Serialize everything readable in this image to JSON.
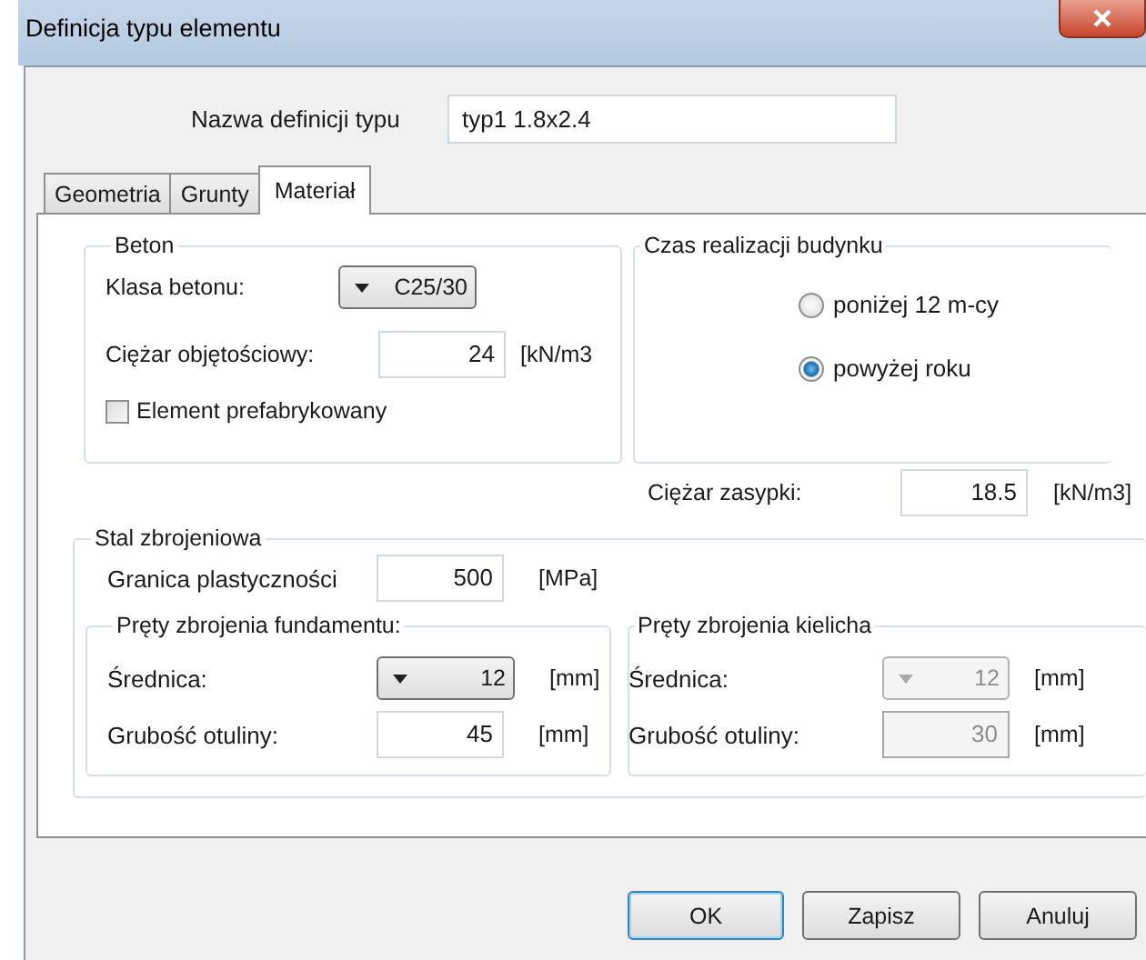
{
  "window": {
    "title": "Definicja typu elementu"
  },
  "type_name": {
    "label": "Nazwa definicji typu",
    "value": "typ1 1.8x2.4"
  },
  "tabs": [
    {
      "label": "Geometria",
      "selected": false
    },
    {
      "label": "Grunty",
      "selected": false
    },
    {
      "label": "Materiał",
      "selected": true
    }
  ],
  "concrete": {
    "title": "Beton",
    "concrete_class": {
      "label": "Klasa betonu:",
      "value": "C25/30"
    },
    "unit_weight": {
      "label": "Ciężar objętościowy:",
      "value": "24",
      "unit": "[kN/m3"
    },
    "precast": {
      "label": "Element prefabrykowany",
      "checked": false
    }
  },
  "construction_time": {
    "title": "Czas realizacji budynku",
    "options": [
      {
        "label": "poniżej 12 m-cy",
        "selected": false
      },
      {
        "label": "powyżej roku",
        "selected": true
      }
    ]
  },
  "backfill_weight": {
    "label": "Ciężar zasypki:",
    "value": "18.5",
    "unit": "[kN/m3]"
  },
  "steel": {
    "title": "Stal zbrojeniowa",
    "yield_strength": {
      "label": "Granica plastyczności",
      "value": "500",
      "unit": "[MPa]"
    },
    "bar_groups": [
      {
        "title": "Pręty zbrojenia fundamentu:",
        "disabled": false,
        "diameter": {
          "label": "Średnica:",
          "value": "12",
          "unit": "[mm]"
        },
        "cover": {
          "label": "Grubość otuliny:",
          "value": "45",
          "unit": "[mm]"
        }
      },
      {
        "title": "Pręty zbrojenia kielicha",
        "disabled": true,
        "diameter": {
          "label": "Średnica:",
          "value": "12",
          "unit": "[mm]"
        },
        "cover": {
          "label": "Grubość otuliny:",
          "value": "30",
          "unit": "[mm]"
        }
      }
    ]
  },
  "buttons": [
    {
      "label": "OK",
      "default": true
    },
    {
      "label": "Zapisz",
      "default": false
    },
    {
      "label": "Anuluj",
      "default": false
    }
  ]
}
